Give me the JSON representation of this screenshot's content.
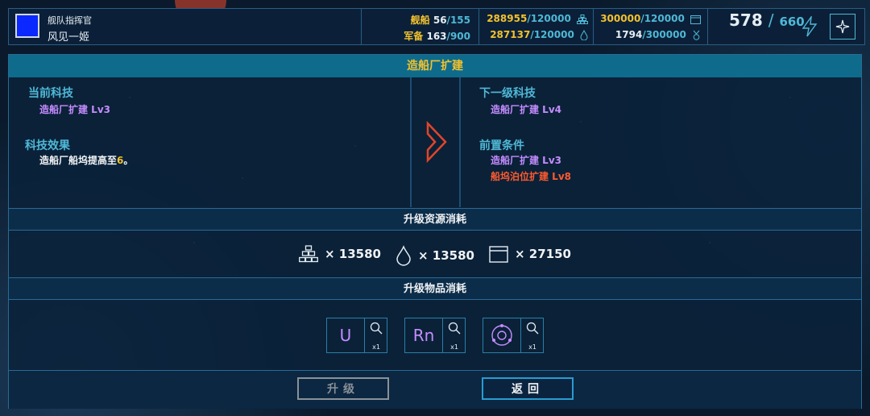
{
  "commander": {
    "title": "舰队指挥官",
    "name": "风见一姬",
    "avatar_color": "#0a28ff"
  },
  "resources": {
    "ships": {
      "label": "舰船",
      "current": "56",
      "max": "155"
    },
    "equipment": {
      "label": "军备",
      "current": "163",
      "max": "900"
    },
    "res1": {
      "current": "288955",
      "max": "120000",
      "icon": "blocks-icon"
    },
    "res2": {
      "current": "287137",
      "max": "120000",
      "icon": "drop-icon"
    },
    "res3": {
      "current": "300000",
      "max": "120000",
      "icon": "calendar-icon"
    },
    "res4": {
      "current": "1794",
      "max": "300000",
      "icon": "medal-icon"
    },
    "energy": {
      "current": "578",
      "max": "660",
      "icon": "lightning-icon"
    }
  },
  "panel": {
    "title": "造船厂扩建",
    "current_tech_label": "当前科技",
    "current_tech": "造船厂扩建 Lv3",
    "effect_label": "科技效果",
    "effect_text": "造船厂船坞提高至",
    "effect_value": "6",
    "effect_suffix": "。",
    "next_tech_label": "下一级科技",
    "next_tech": "造船厂扩建 Lv4",
    "prereq_label": "前置条件",
    "prereq_met": "造船厂扩建 Lv3",
    "prereq_unmet": "船坞泊位扩建 Lv8",
    "resource_cost_header": "升级资源消耗",
    "costs": [
      {
        "icon": "blocks-icon",
        "value": "× 13580"
      },
      {
        "icon": "drop-icon",
        "value": "× 13580"
      },
      {
        "icon": "calendar-icon",
        "value": "× 27150"
      }
    ],
    "item_cost_header": "升级物品消耗",
    "items": [
      {
        "symbol": "U",
        "count": "x1"
      },
      {
        "symbol": "Rn",
        "count": "x1"
      },
      {
        "symbol": "",
        "count": "x1"
      }
    ],
    "upgrade_label": "升级",
    "back_label": "返回"
  },
  "colors": {
    "accent_cyan": "#4fb8d6",
    "accent_yellow": "#f2c12e",
    "purple": "#c58cff",
    "red": "#ff5a2e"
  }
}
